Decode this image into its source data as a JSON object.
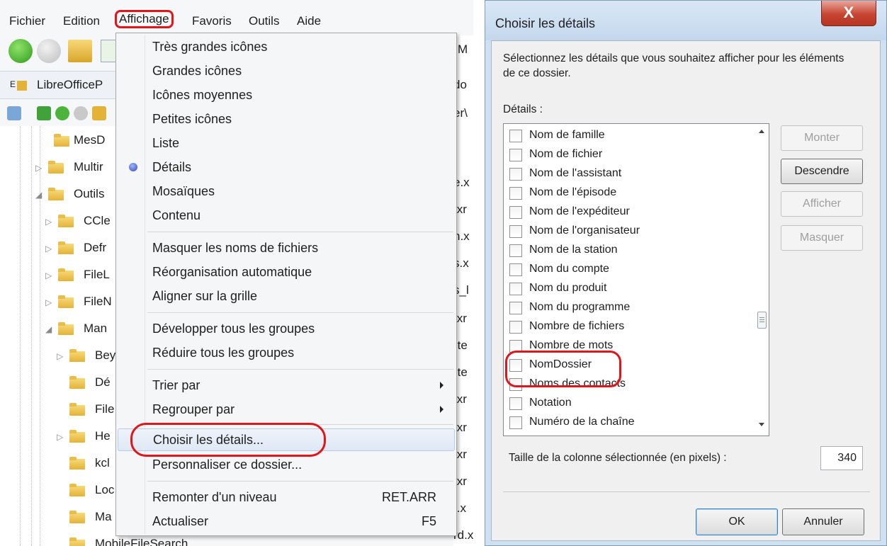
{
  "menubar": {
    "items": [
      "Fichier",
      "Edition",
      "Affichage",
      "Favoris",
      "Outils",
      "Aide"
    ]
  },
  "address": {
    "text": "LibreOfficeP",
    "prefix": "E"
  },
  "tree": {
    "items": [
      {
        "label": "MesD",
        "expander": ""
      },
      {
        "label": "Multir",
        "expander": "▷"
      },
      {
        "label": "Outils",
        "expander": "◢"
      },
      {
        "label": "CCle",
        "expander": "▷"
      },
      {
        "label": "Defr",
        "expander": "▷"
      },
      {
        "label": "FileL",
        "expander": "▷"
      },
      {
        "label": "FileN",
        "expander": "▷"
      },
      {
        "label": "Man",
        "expander": "◢"
      },
      {
        "label": "Bey",
        "expander": "▷"
      },
      {
        "label": "Dé",
        "expander": ""
      },
      {
        "label": "File",
        "expander": ""
      },
      {
        "label": "He",
        "expander": "▷"
      },
      {
        "label": "kcl",
        "expander": ""
      },
      {
        "label": "Loc",
        "expander": ""
      },
      {
        "label": "Ma",
        "expander": ""
      },
      {
        "label": "MobileFileSearch",
        "expander": ""
      }
    ]
  },
  "files": {
    "fragments": [
      "M",
      "do",
      "er\\",
      "e.x",
      ".xr",
      "n.x",
      "s.x",
      "s_l",
      ".xr",
      "-te",
      "-te",
      ".xr",
      ".xr",
      ".xr",
      ".xr",
      "t.x",
      "rd.xr"
    ]
  },
  "menu": {
    "items": [
      {
        "label": "Très grandes icônes",
        "shortcut": "",
        "submenu": false,
        "checked": false,
        "selected": false
      },
      {
        "label": "Grandes icônes",
        "shortcut": "",
        "submenu": false,
        "checked": false,
        "selected": false
      },
      {
        "label": "Icônes moyennes",
        "shortcut": "",
        "submenu": false,
        "checked": false,
        "selected": false
      },
      {
        "label": "Petites icônes",
        "shortcut": "",
        "submenu": false,
        "checked": false,
        "selected": false
      },
      {
        "label": "Liste",
        "shortcut": "",
        "submenu": false,
        "checked": false,
        "selected": false
      },
      {
        "label": "Détails",
        "shortcut": "",
        "submenu": false,
        "checked": true,
        "selected": false
      },
      {
        "label": "Mosaïques",
        "shortcut": "",
        "submenu": false,
        "checked": false,
        "selected": false
      },
      {
        "label": "Contenu",
        "shortcut": "",
        "submenu": false,
        "checked": false,
        "selected": false
      },
      {
        "label": "Masquer les noms de fichiers",
        "shortcut": "",
        "submenu": false,
        "checked": false,
        "selected": false
      },
      {
        "label": "Réorganisation automatique",
        "shortcut": "",
        "submenu": false,
        "checked": false,
        "selected": false
      },
      {
        "label": "Aligner sur la grille",
        "shortcut": "",
        "submenu": false,
        "checked": false,
        "selected": false
      },
      {
        "label": "Développer tous les groupes",
        "shortcut": "",
        "submenu": false,
        "checked": false,
        "selected": false
      },
      {
        "label": "Réduire tous les groupes",
        "shortcut": "",
        "submenu": false,
        "checked": false,
        "selected": false
      },
      {
        "label": "Trier par",
        "shortcut": "",
        "submenu": true,
        "checked": false,
        "selected": false
      },
      {
        "label": "Regrouper par",
        "shortcut": "",
        "submenu": true,
        "checked": false,
        "selected": false
      },
      {
        "label": "Choisir les détails...",
        "shortcut": "",
        "submenu": false,
        "checked": false,
        "selected": true
      },
      {
        "label": "Personnaliser ce dossier...",
        "shortcut": "",
        "submenu": false,
        "checked": false,
        "selected": false
      },
      {
        "label": "Remonter d'un niveau",
        "shortcut": "RET.ARR",
        "submenu": false,
        "checked": false,
        "selected": false
      },
      {
        "label": "Actualiser",
        "shortcut": "F5",
        "submenu": false,
        "checked": false,
        "selected": false
      }
    ]
  },
  "dialog": {
    "title": "Choisir les détails",
    "close_glyph": "X",
    "description": "Sélectionnez les détails que vous souhaitez afficher pour les éléments de ce dossier.",
    "details_label": "Détails :",
    "items": [
      {
        "label": "Nom de famille",
        "checked": false
      },
      {
        "label": "Nom de fichier",
        "checked": false
      },
      {
        "label": "Nom de l'assistant",
        "checked": false
      },
      {
        "label": "Nom de l'épisode",
        "checked": false
      },
      {
        "label": "Nom de l'expéditeur",
        "checked": false
      },
      {
        "label": "Nom de l'organisateur",
        "checked": false
      },
      {
        "label": "Nom de la station",
        "checked": false
      },
      {
        "label": "Nom du compte",
        "checked": false
      },
      {
        "label": "Nom du produit",
        "checked": false
      },
      {
        "label": "Nom du programme",
        "checked": false
      },
      {
        "label": "Nombre de fichiers",
        "checked": false
      },
      {
        "label": "Nombre de mots",
        "checked": false
      },
      {
        "label": "NomDossier",
        "checked": false
      },
      {
        "label": "Noms des contacts",
        "checked": false
      },
      {
        "label": "Notation",
        "checked": false
      },
      {
        "label": "Numéro de la chaîne",
        "checked": false
      }
    ],
    "buttons": {
      "monter": "Monter",
      "descendre": "Descendre",
      "afficher": "Afficher",
      "masquer": "Masquer",
      "ok": "OK",
      "annuler": "Annuler"
    },
    "size_label": "Taille de la colonne sélectionnée (en pixels) :",
    "size_value": "340"
  },
  "colors": {
    "highlight_red": "#e0161b",
    "accent_blue": "#3c7fb1",
    "folder_yellow": "#e3b337"
  }
}
